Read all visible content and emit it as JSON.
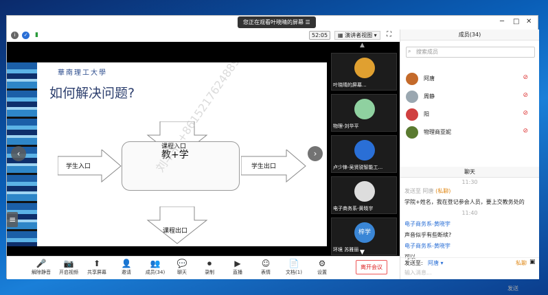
{
  "banner": "您正在观看叶晓晴的屏幕",
  "timer": "52:05",
  "view_mode": "演讲者视图",
  "slide": {
    "university": "華南理工大學",
    "title": "如何解决问题?",
    "center": "教+学",
    "labels": {
      "top": "课程入口",
      "left": "学生入口",
      "right": "学生出口",
      "bottom": "课程出口"
    },
    "watermark": "刘华平 +8615217624889"
  },
  "gallery": [
    {
      "name": "叶晓晴的屏幕...",
      "color": "#e0a030"
    },
    {
      "name": "物理-刘华平",
      "color": "#8fd1a0"
    },
    {
      "name": "卢少锋-吴贤锐智能工...",
      "color": "#2a6fd6"
    },
    {
      "name": "电子商务系-黄晓宇",
      "color": "#ddd"
    },
    {
      "name": "环境 苏雅丽",
      "avatar_text": "梓学",
      "color": "#3a86d6"
    }
  ],
  "toolbar": [
    {
      "label": "解除静音",
      "glyph": "🎤"
    },
    {
      "label": "开启视频",
      "glyph": "📷"
    },
    {
      "label": "共享屏幕",
      "glyph": "⬆"
    },
    {
      "label": "邀请",
      "glyph": "👤"
    },
    {
      "label": "成员(34)",
      "glyph": "👥"
    },
    {
      "label": "聊天",
      "glyph": "💬"
    },
    {
      "label": "录制",
      "glyph": "⏺"
    },
    {
      "label": "直播",
      "glyph": "▶"
    },
    {
      "label": "表情",
      "glyph": "☺"
    },
    {
      "label": "文档(1)",
      "glyph": "📄"
    },
    {
      "label": "设置",
      "glyph": "⚙"
    }
  ],
  "leave": "离开会议",
  "members_header": "成员(34)",
  "search_placeholder": "搜索成员",
  "members": [
    {
      "name": "阿唐",
      "color": "#c46a2a"
    },
    {
      "name": "周静",
      "color": "#9aa7b0"
    },
    {
      "name": "阳",
      "color": "#d04040"
    },
    {
      "name": "物理商亚妮",
      "color": "#5a7a30"
    }
  ],
  "chat_header": "聊天",
  "chat": {
    "time1": "11:30",
    "from1": "发送至 阿唐",
    "private": "(私聊)",
    "msg1": "学院+姓名，我在登记参会人员，要上交教务处的",
    "time2": "11:40",
    "sender2": "电子商务系-黄晓宇",
    "msg2": "声音似乎有些断续?",
    "sender3": "电子商务系-黄晓宇",
    "msg3": "可以",
    "send_to": "发送至:",
    "send_target": "阿唐",
    "private_tag": "私聊",
    "input_placeholder": "输入消息...",
    "send_btn": "发送"
  }
}
